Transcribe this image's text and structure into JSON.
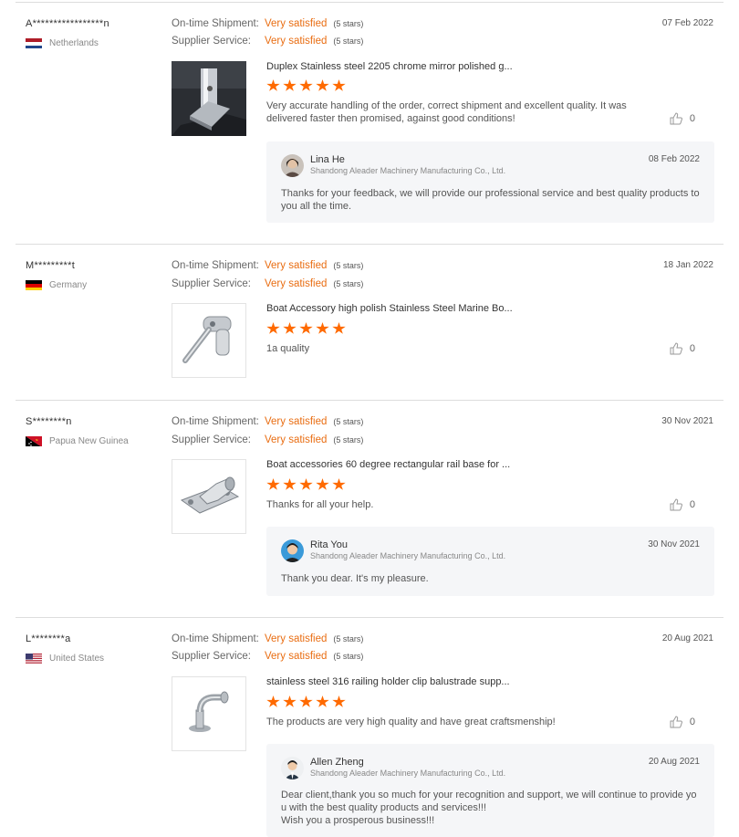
{
  "labels": {
    "shipment": "On-time Shipment:",
    "service": "Supplier Service:",
    "satisfied": "Very satisfied",
    "five_stars": "(5 stars)"
  },
  "reviews": [
    {
      "buyer": "A*****************n",
      "country": "Netherlands",
      "flag": "netherlands-flag-icon",
      "date": "07 Feb 2022",
      "product": "Duplex Stainless steel 2205 chrome mirror polished g...",
      "rating": 5,
      "comment": "Very accurate handling of the order, correct shipment and excellent quality. It was delivered faster then promised, against good conditions!",
      "likes": "0",
      "reply": {
        "name": "Lina He",
        "company": "Shandong Aleader Machinery Manufacturing Co., Ltd.",
        "date": "08 Feb 2022",
        "text": "Thanks for your feedback, we will provide our professional service and best quality products to you all the time."
      }
    },
    {
      "buyer": "M*********t",
      "country": "Germany",
      "flag": "germany-flag-icon",
      "date": "18 Jan 2022",
      "product": "Boat Accessory high polish Stainless Steel Marine Bo...",
      "rating": 5,
      "comment": "1a quality",
      "likes": "0"
    },
    {
      "buyer": "S********n",
      "country": "Papua New Guinea",
      "flag": "papua-new-guinea-flag-icon",
      "date": "30 Nov 2021",
      "product": "Boat accessories 60 degree rectangular rail base for ...",
      "rating": 5,
      "comment": "Thanks for all your help.",
      "likes": "0",
      "reply": {
        "name": "Rita You",
        "company": "Shandong Aleader Machinery Manufacturing Co., Ltd.",
        "date": "30 Nov 2021",
        "text": "Thank you dear. It's my pleasure."
      }
    },
    {
      "buyer": "L********a",
      "country": "United States",
      "flag": "united-states-flag-icon",
      "date": "20 Aug 2021",
      "product": "stainless steel 316 railing holder clip balustrade supp...",
      "rating": 5,
      "comment": "The products are very high quality and have great craftsmenship!",
      "likes": "0",
      "reply": {
        "name": "Allen Zheng",
        "company": "Shandong Aleader Machinery Manufacturing Co., Ltd.",
        "date": "20 Aug 2021",
        "text": "Dear client,thank you so much for your recognition and support, we will continue to provide you with the best quality products and services!!!",
        "text2": "Wish you a prosperous business!!!"
      }
    }
  ]
}
